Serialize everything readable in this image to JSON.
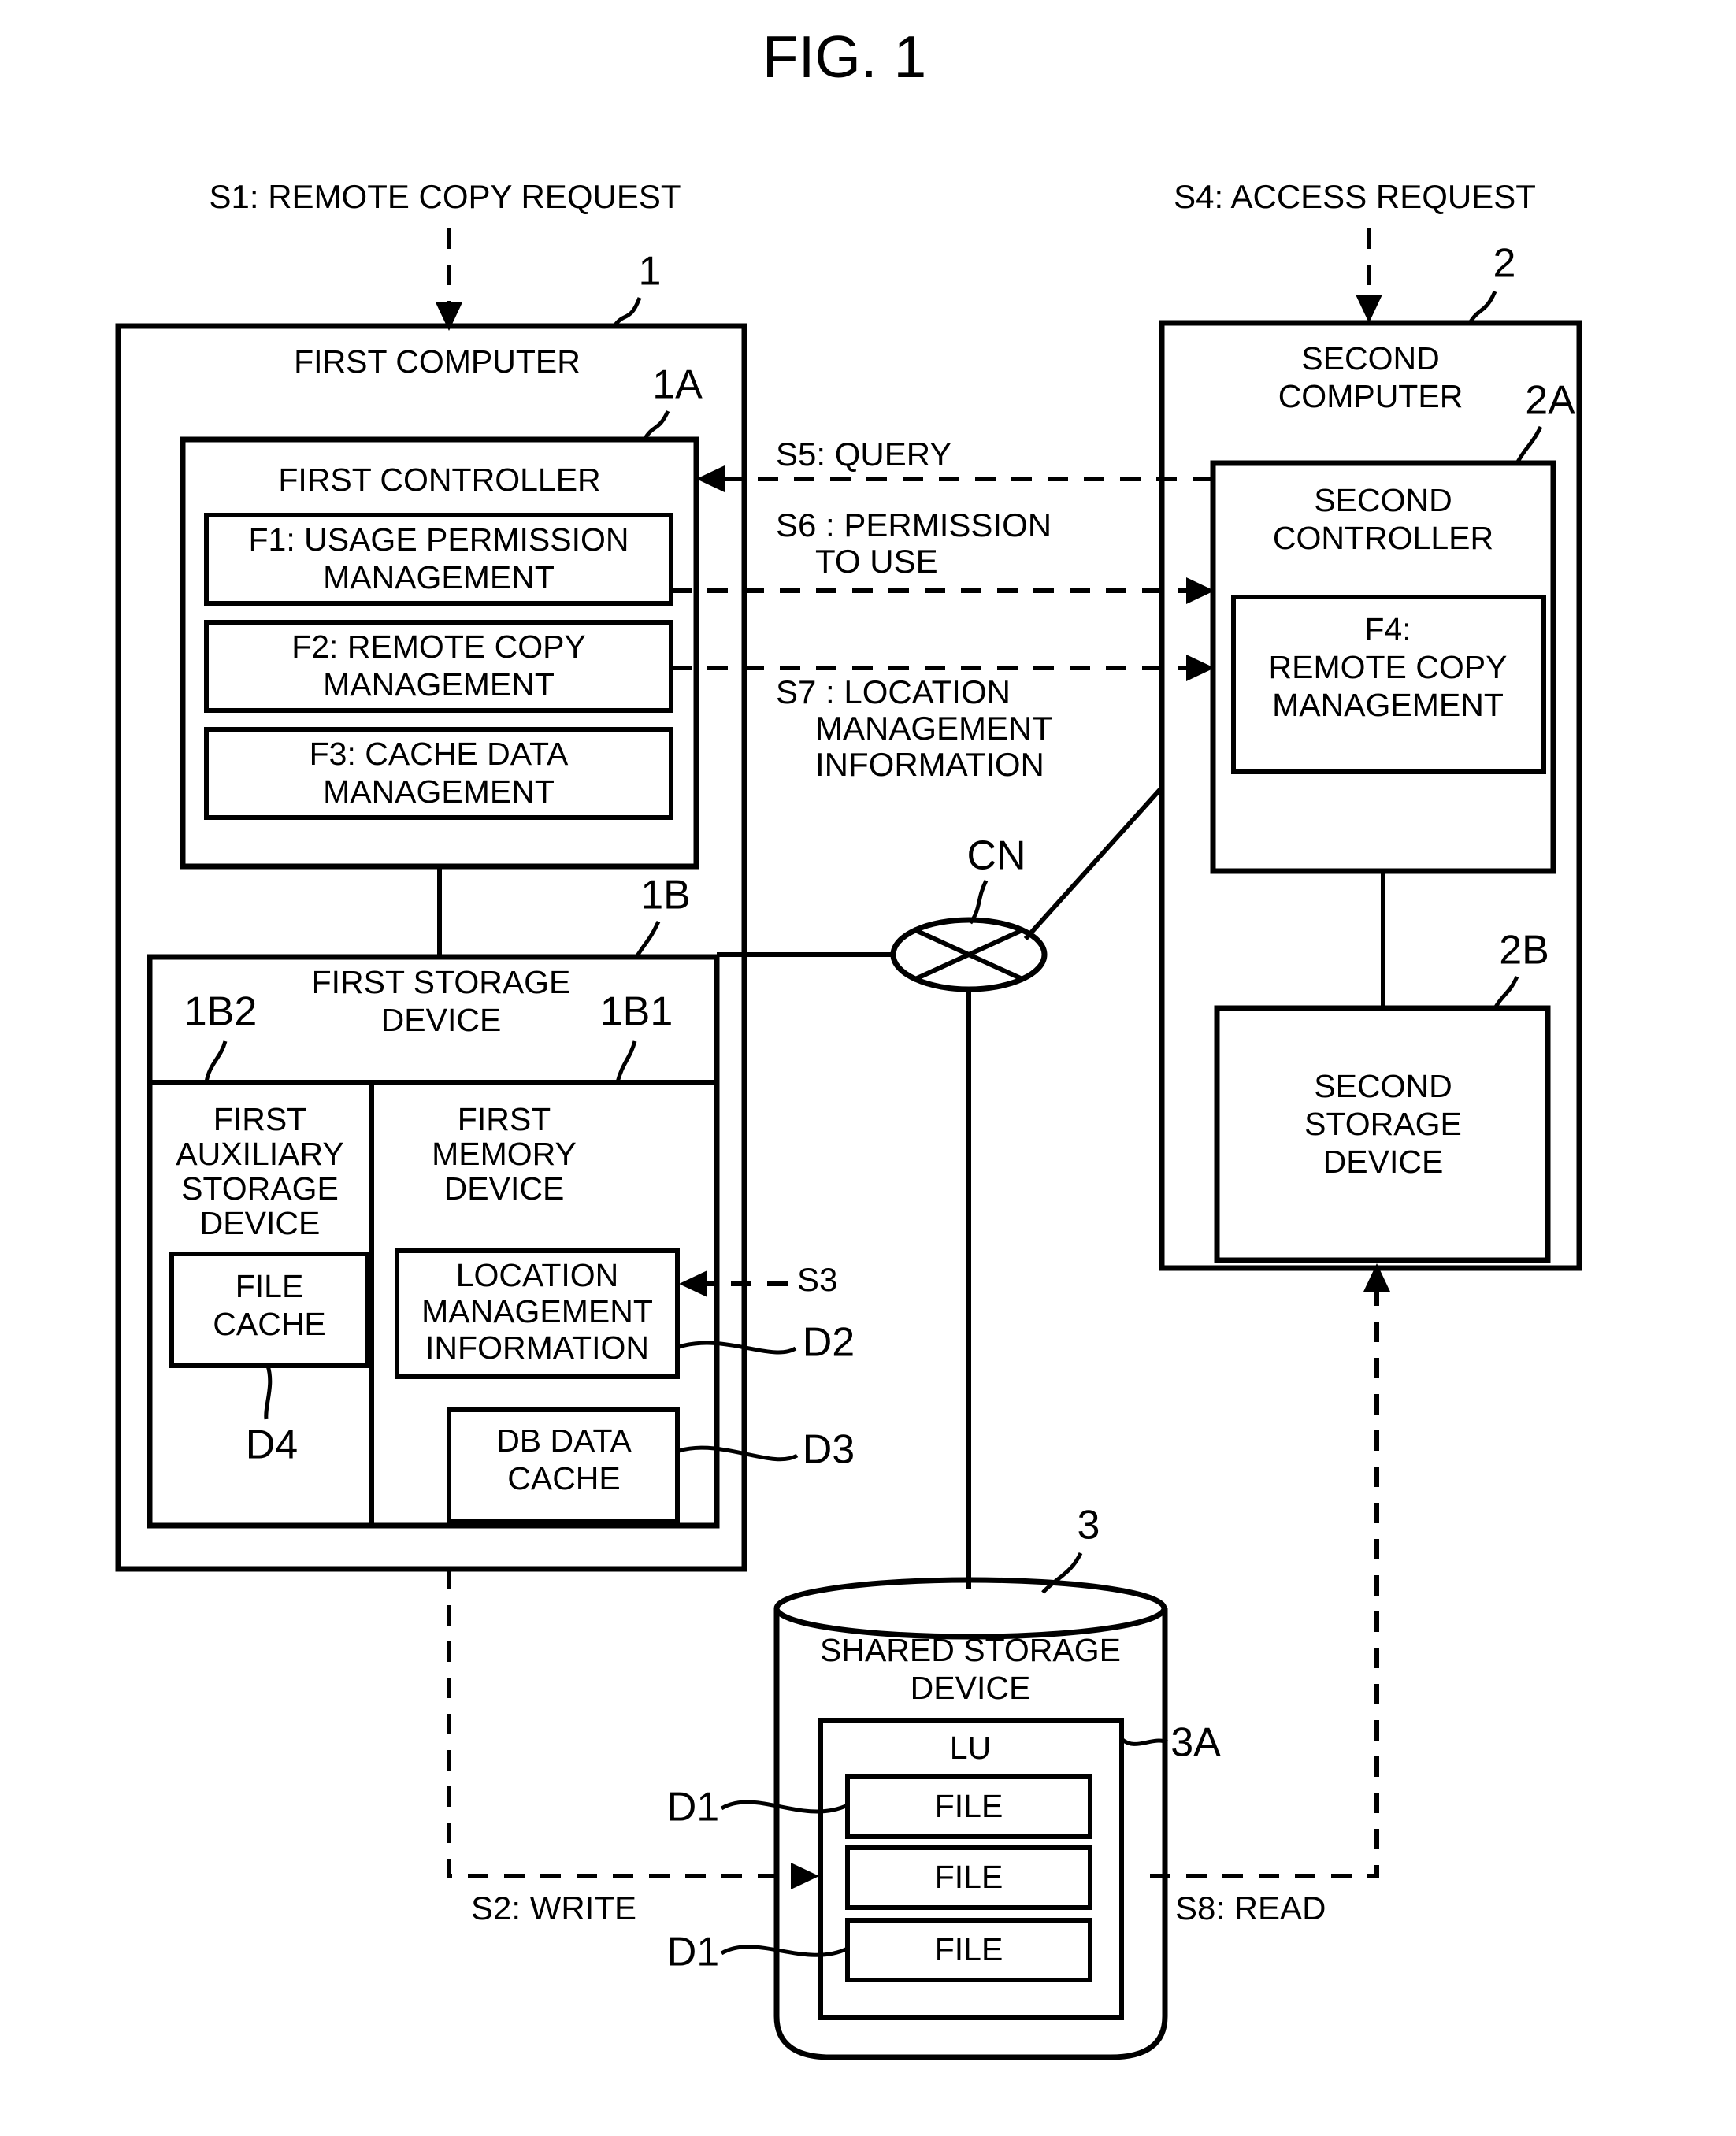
{
  "figure": {
    "title": "FIG. 1"
  },
  "signals": {
    "s1": "S1: REMOTE COPY REQUEST",
    "s2": "S2: WRITE",
    "s3": "S3",
    "s4": "S4: ACCESS REQUEST",
    "s5": "S5: QUERY",
    "s6_line1": "S6 : PERMISSION",
    "s6_line2": "TO USE",
    "s7_line1": "S7 : LOCATION",
    "s7_line2": "MANAGEMENT",
    "s7_line3": "INFORMATION",
    "s8": "S8: READ"
  },
  "first_computer": {
    "ref": "1",
    "title": "FIRST COMPUTER",
    "controller": {
      "ref": "1A",
      "title": "FIRST CONTROLLER",
      "functions": [
        {
          "line1": "F1: USAGE PERMISSION",
          "line2": "MANAGEMENT"
        },
        {
          "line1": "F2: REMOTE COPY",
          "line2": "MANAGEMENT"
        },
        {
          "line1": "F3: CACHE DATA",
          "line2": "MANAGEMENT"
        }
      ]
    },
    "storage": {
      "ref": "1B",
      "title_line1": "FIRST STORAGE",
      "title_line2": "DEVICE",
      "auxiliary": {
        "ref": "1B2",
        "title_line1": "FIRST",
        "title_line2": "AUXILIARY",
        "title_line3": "STORAGE",
        "title_line4": "DEVICE",
        "cache": {
          "line1": "FILE",
          "line2": "CACHE",
          "ref": "D4"
        }
      },
      "memory": {
        "ref": "1B1",
        "title_line1": "FIRST",
        "title_line2": "MEMORY",
        "title_line3": "DEVICE",
        "location_info": {
          "line1": "LOCATION",
          "line2": "MANAGEMENT",
          "line3": "INFORMATION",
          "ref": "D2"
        },
        "db_cache": {
          "line1": "DB DATA",
          "line2": "CACHE",
          "ref": "D3"
        }
      }
    }
  },
  "network": {
    "ref": "CN"
  },
  "second_computer": {
    "ref": "2",
    "title_line1": "SECOND",
    "title_line2": "COMPUTER",
    "controller": {
      "ref": "2A",
      "title_line1": "SECOND",
      "title_line2": "CONTROLLER",
      "function": {
        "line1": "F4:",
        "line2": "REMOTE COPY",
        "line3": "MANAGEMENT"
      }
    },
    "storage": {
      "ref": "2B",
      "title_line1": "SECOND",
      "title_line2": "STORAGE",
      "title_line3": "DEVICE"
    }
  },
  "shared_storage": {
    "ref": "3",
    "title_line1": "SHARED STORAGE",
    "title_line2": "DEVICE",
    "lu": {
      "ref": "3A",
      "label": "LU",
      "files": [
        {
          "label": "FILE",
          "ref": "D1"
        },
        {
          "label": "FILE",
          "ref": ""
        },
        {
          "label": "FILE",
          "ref": "D1"
        }
      ]
    }
  }
}
